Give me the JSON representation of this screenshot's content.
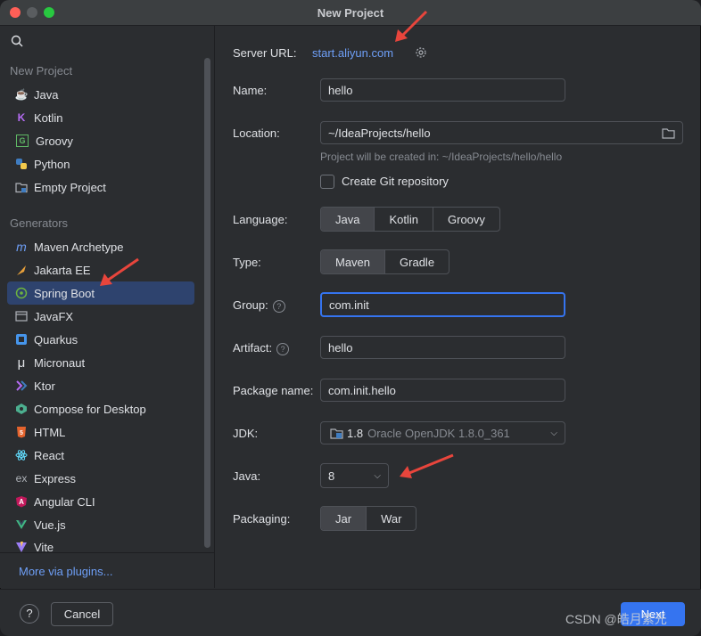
{
  "window": {
    "title": "New Project"
  },
  "sidebar": {
    "section_new": "New Project",
    "new_items": [
      {
        "label": "Java",
        "icon": "java-cup-icon"
      },
      {
        "label": "Kotlin",
        "icon": "kotlin-icon"
      },
      {
        "label": "Groovy",
        "icon": "groovy-icon"
      },
      {
        "label": "Python",
        "icon": "python-icon"
      },
      {
        "label": "Empty Project",
        "icon": "empty-project-icon"
      }
    ],
    "section_generators": "Generators",
    "generator_items": [
      {
        "label": "Maven Archetype",
        "icon": "maven-icon"
      },
      {
        "label": "Jakarta EE",
        "icon": "jakarta-icon"
      },
      {
        "label": "Spring Boot",
        "icon": "spring-boot-icon",
        "selected": true
      },
      {
        "label": "JavaFX",
        "icon": "javafx-icon"
      },
      {
        "label": "Quarkus",
        "icon": "quarkus-icon"
      },
      {
        "label": "Micronaut",
        "icon": "micronaut-icon"
      },
      {
        "label": "Ktor",
        "icon": "ktor-icon"
      },
      {
        "label": "Compose for Desktop",
        "icon": "compose-icon"
      },
      {
        "label": "HTML",
        "icon": "html5-icon"
      },
      {
        "label": "React",
        "icon": "react-icon"
      },
      {
        "label": "Express",
        "icon": "express-icon"
      },
      {
        "label": "Angular CLI",
        "icon": "angular-icon"
      },
      {
        "label": "Vue.js",
        "icon": "vue-icon"
      },
      {
        "label": "Vite",
        "icon": "vite-icon"
      }
    ],
    "more_plugins": "More via plugins..."
  },
  "form": {
    "server_url_label": "Server URL:",
    "server_url_value": "start.aliyun.com",
    "name_label": "Name:",
    "name_value": "hello",
    "location_label": "Location:",
    "location_value": "~/IdeaProjects/hello",
    "location_hint": "Project will be created in: ~/IdeaProjects/hello/hello",
    "git_label": "Create Git repository",
    "language_label": "Language:",
    "language_options": [
      "Java",
      "Kotlin",
      "Groovy"
    ],
    "language_selected": "Java",
    "type_label": "Type:",
    "type_options": [
      "Maven",
      "Gradle"
    ],
    "type_selected": "Maven",
    "group_label": "Group:",
    "group_value": "com.init",
    "artifact_label": "Artifact:",
    "artifact_value": "hello",
    "package_label": "Package name:",
    "package_value": "com.init.hello",
    "jdk_label": "JDK:",
    "jdk_version": "1.8",
    "jdk_name": "Oracle OpenJDK 1.8.0_361",
    "java_label": "Java:",
    "java_value": "8",
    "packaging_label": "Packaging:",
    "packaging_options": [
      "Jar",
      "War"
    ],
    "packaging_selected": "Jar"
  },
  "footer": {
    "help": "?",
    "cancel": "Cancel",
    "next": "Next",
    "watermark": "CSDN @皓月紫光"
  },
  "colors": {
    "accent": "#3574f0",
    "link": "#6e9ff7",
    "selection": "#2e436e",
    "annotation_arrow": "#e8453c"
  }
}
